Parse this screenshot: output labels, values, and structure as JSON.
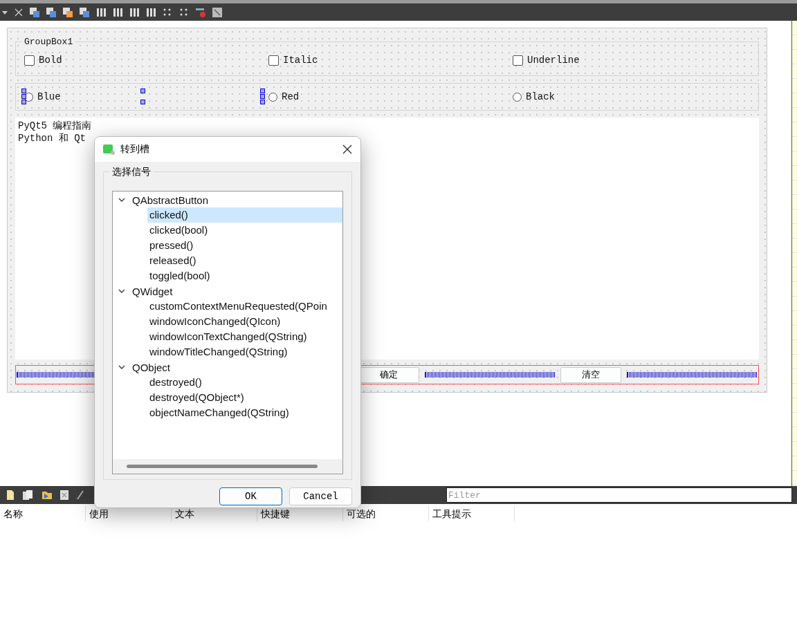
{
  "form": {
    "groupbox": {
      "title": "GroupBox1",
      "checkboxes": [
        {
          "label": "Bold",
          "checked": false
        },
        {
          "label": "Italic",
          "checked": false
        },
        {
          "label": "Underline",
          "checked": false
        }
      ]
    },
    "radios": [
      {
        "label": "Blue",
        "checked": false,
        "selected": true
      },
      {
        "label": "Red",
        "checked": false,
        "selected": false
      },
      {
        "label": "Black",
        "checked": false,
        "selected": false
      }
    ],
    "text_edit": {
      "lines": [
        "PyQt5 编程指南",
        "Python 和 Qt"
      ]
    },
    "buttons": [
      "确定",
      "清空"
    ]
  },
  "dialog": {
    "title": "转到槽",
    "group_title": "选择信号",
    "tree": [
      {
        "label": "QAbstractButton",
        "expanded": true,
        "children": [
          {
            "label": "clicked()",
            "selected": true
          },
          {
            "label": "clicked(bool)",
            "selected": false
          },
          {
            "label": "pressed()",
            "selected": false
          },
          {
            "label": "released()",
            "selected": false
          },
          {
            "label": "toggled(bool)",
            "selected": false
          }
        ]
      },
      {
        "label": "QWidget",
        "expanded": true,
        "children": [
          {
            "label": "customContextMenuRequested(QPoin",
            "selected": false
          },
          {
            "label": "windowIconChanged(QIcon)",
            "selected": false
          },
          {
            "label": "windowIconTextChanged(QString)",
            "selected": false
          },
          {
            "label": "windowTitleChanged(QString)",
            "selected": false
          }
        ]
      },
      {
        "label": "QObject",
        "expanded": true,
        "children": [
          {
            "label": "destroyed()",
            "selected": false
          },
          {
            "label": "destroyed(QObject*)",
            "selected": false
          },
          {
            "label": "objectNameChanged(QString)",
            "selected": false
          }
        ]
      }
    ],
    "buttons": [
      {
        "label": "OK",
        "default": true
      },
      {
        "label": "Cancel",
        "default": false
      }
    ]
  },
  "action_editor": {
    "filter": {
      "placeholder": "Filter"
    },
    "columns": [
      "名称",
      "使用",
      "文本",
      "快捷键",
      "可选的",
      "工具提示"
    ]
  }
}
